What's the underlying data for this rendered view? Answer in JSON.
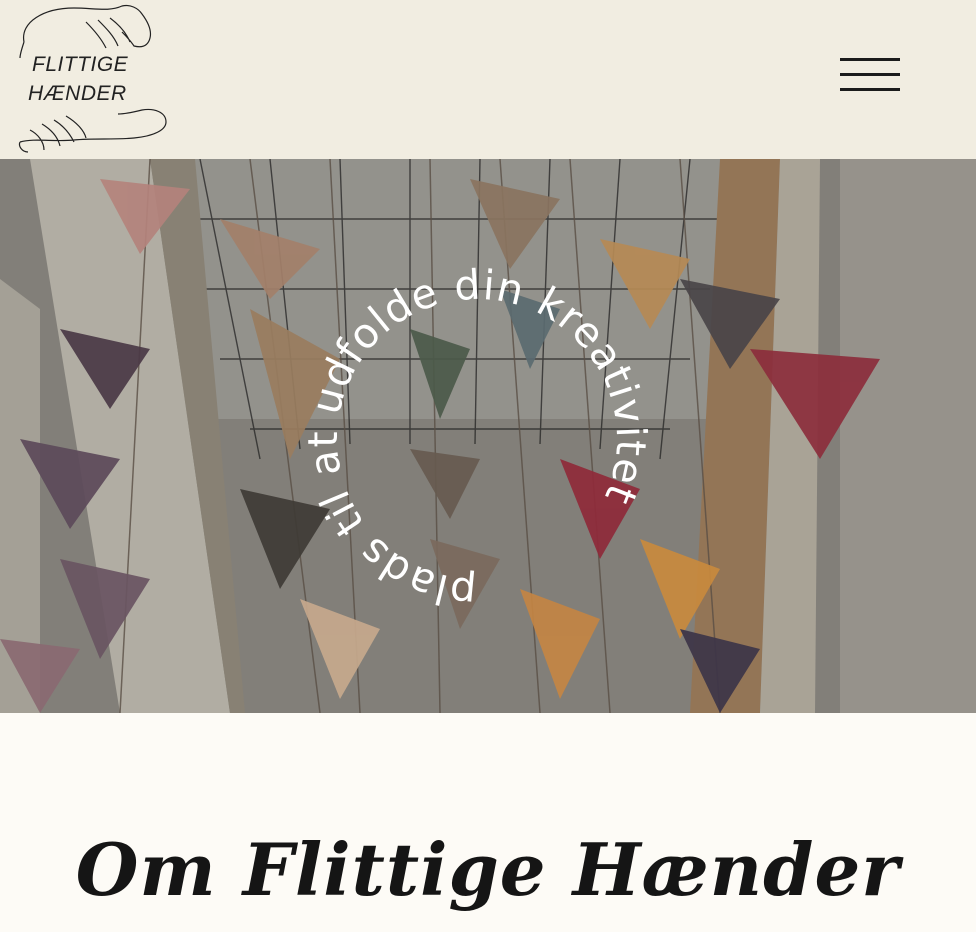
{
  "header": {
    "logo": {
      "line1": "FLITTIGE",
      "line2": "HÆNDER"
    },
    "menu_icon": "hamburger-menu-icon"
  },
  "hero": {
    "circle_text": "plads til at udfolde din kreativitet",
    "image": "hanging-knitted-pennant-garlands"
  },
  "about": {
    "title": "Om Flittige Hænder"
  },
  "colors": {
    "header_bg": "#f1ede1",
    "page_bg": "#fdfbf6",
    "text": "#151515",
    "circle_text": "#ffffff"
  }
}
